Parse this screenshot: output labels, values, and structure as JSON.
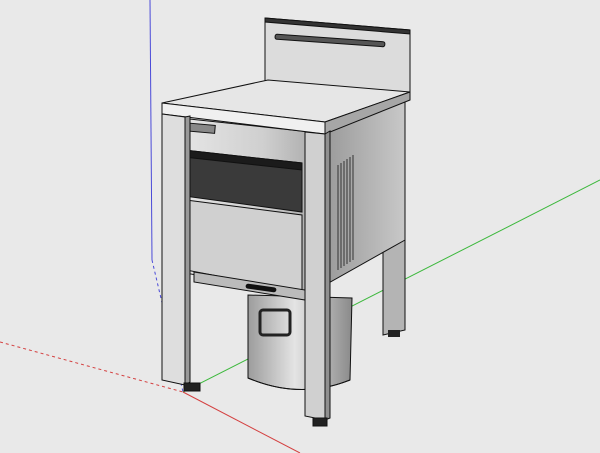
{
  "viewport": {
    "background": "#e9e9e9",
    "axes": {
      "x_color": "#d44040",
      "y_color": "#3cb83c",
      "z_color": "#4a4ad8"
    }
  },
  "model": {
    "body_color": "#d8d8d8",
    "shadow_color": "#8a8a8a",
    "outline_color": "#111111"
  }
}
